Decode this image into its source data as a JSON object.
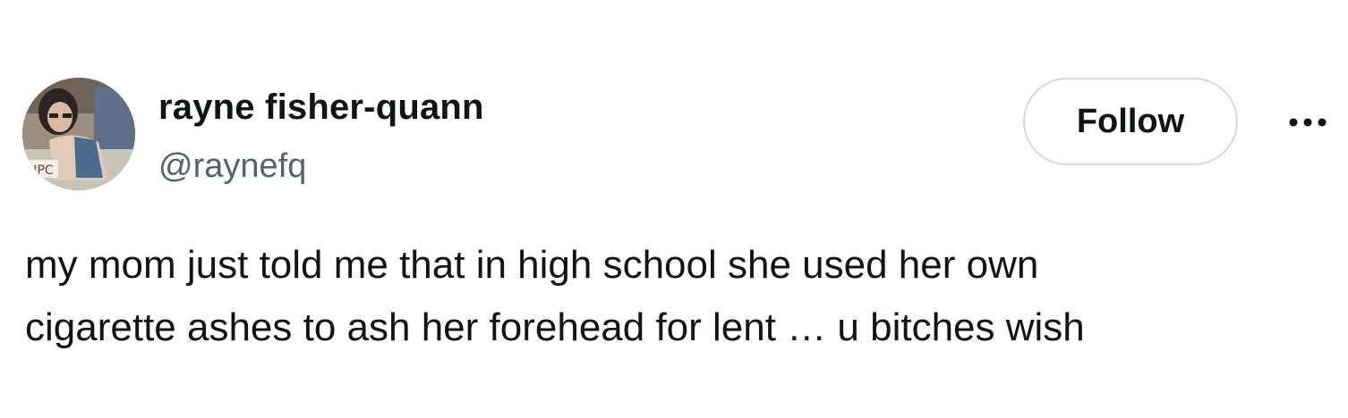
{
  "author": {
    "display_name": "rayne fisher-quann",
    "handle": "@raynefq"
  },
  "actions": {
    "follow_label": "Follow",
    "more_icon": "more-horizontal-icon"
  },
  "tweet": {
    "text": "my mom just told me that in high school she used her own\ncigarette ashes to ash her forehead for lent … u bitches wish"
  },
  "colors": {
    "text_primary": "#0f1419",
    "text_secondary": "#536471",
    "button_border": "#cfd9de",
    "background": "#ffffff"
  }
}
